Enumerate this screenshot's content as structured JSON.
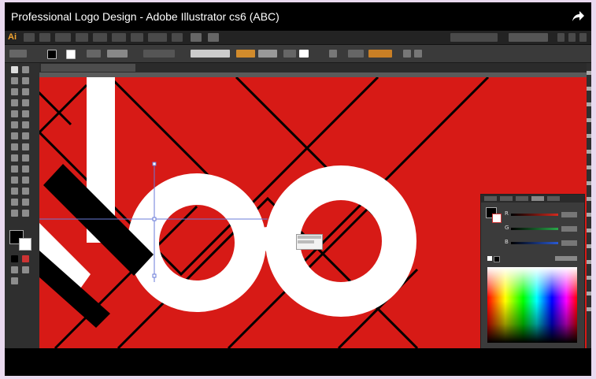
{
  "video": {
    "title": "Professional Logo Design - Adobe Illustrator cs6 (ABC)",
    "share_icon": "share-arrow-icon"
  },
  "illustrator": {
    "app_logo": "Ai",
    "canvas_color": "#d71a16",
    "artwork_color": "#ffffff",
    "accent_black": "#000000"
  },
  "color_panel": {
    "sliders": [
      {
        "label": "R",
        "color": "#d32a1e"
      },
      {
        "label": "G",
        "color": "#2aa84a"
      },
      {
        "label": "B",
        "color": "#2a5ad3"
      }
    ]
  }
}
